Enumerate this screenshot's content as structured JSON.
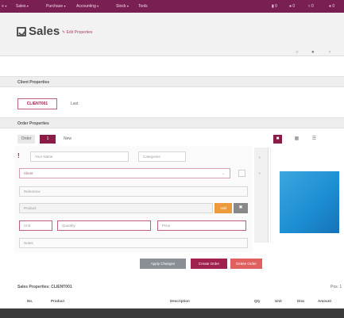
{
  "nav": {
    "menu_items": [
      "Sales",
      "Purchase",
      "Accounting",
      "Stock",
      "Tools"
    ],
    "right_items": [
      "0",
      "0",
      "0",
      "0"
    ]
  },
  "header": {
    "title": "Sales",
    "edit_link": "Edit Properties",
    "tools": [
      "○",
      "●",
      "›"
    ]
  },
  "general": {
    "section_title": "Client Properties",
    "code_value": "CLIENT001",
    "code_label": "Last"
  },
  "order": {
    "section_title": "Order Properties",
    "tabs": [
      "Order",
      "1",
      "New"
    ],
    "view_buttons": [
      "■",
      "▦",
      "☰"
    ]
  },
  "form": {
    "placeholders": {
      "name": "Your Name",
      "category": "Categories",
      "client": "Client",
      "reference": "Reference",
      "product": "Product",
      "unit": "Unit",
      "quantity": "Quantity",
      "price": "Price",
      "notes": "Notes"
    },
    "product_btn": "Add"
  },
  "actions": {
    "secondary_btn": "Apply Changes",
    "primary_btn": "Create Order",
    "danger_btn": "Delete Order"
  },
  "stock": {
    "section_title": "Sales Properties: CLIENT001",
    "columns": [
      "No.",
      "Product",
      "Description",
      "Qty",
      "Unit",
      "Disc",
      "Amount"
    ],
    "right_label": "Pos: 1"
  },
  "colors": {
    "nav": "#7a1f52",
    "accent": "#8b1c48",
    "orange": "#ec9a3c",
    "danger": "#e06060",
    "image": "#2a9ad9"
  }
}
